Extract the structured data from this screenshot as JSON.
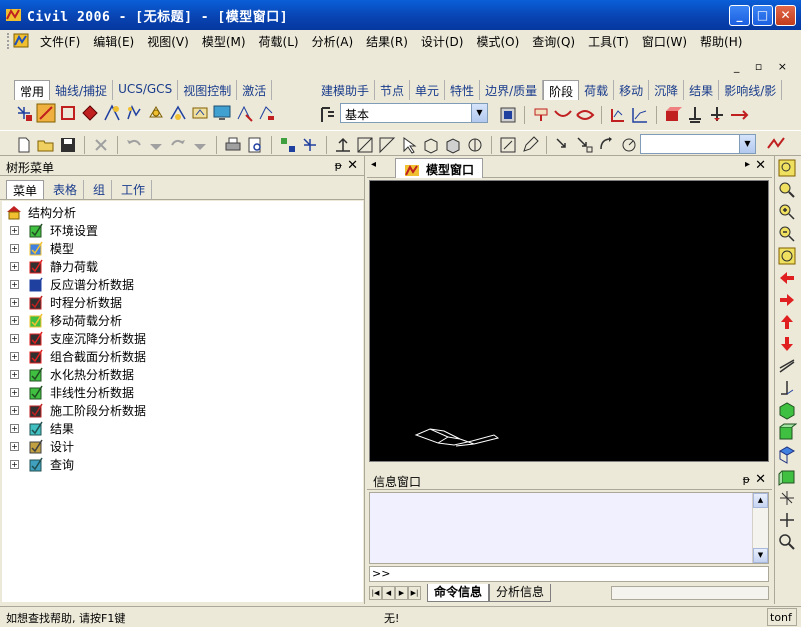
{
  "window": {
    "title": "Civil 2006 - [无标题] - [模型窗口]",
    "minimize": "_",
    "maximize": "□",
    "close": "✕"
  },
  "menu": {
    "items": [
      "文件(F)",
      "编辑(E)",
      "视图(V)",
      "模型(M)",
      "荷载(L)",
      "分析(A)",
      "结果(R)",
      "设计(D)",
      "模式(O)",
      "查询(Q)",
      "工具(T)",
      "窗口(W)",
      "帮助(H)"
    ],
    "mdi_controls": "_ ▫ ×"
  },
  "toolbar_tabs_left": [
    "常用",
    "轴线/捕捉",
    "UCS/GCS",
    "视图控制",
    "激活"
  ],
  "toolbar_tabs_right": [
    "建模助手",
    "节点",
    "单元",
    "特性",
    "边界/质量",
    "阶段",
    "荷载",
    "移动",
    "沉降",
    "结果",
    "影响线/影"
  ],
  "toolbar_active_left": "常用",
  "toolbar_active_right": "阶段",
  "stage_select": {
    "value": "基本"
  },
  "tree_panel": {
    "title": "树形菜单",
    "pin": "ᵽ",
    "close": "✕",
    "subtabs": [
      "菜单",
      "表格",
      "组",
      "工作"
    ],
    "active_subtab": "菜单",
    "root": "结构分析",
    "items": [
      {
        "label": "环境设置",
        "icon": "settings-check-icon"
      },
      {
        "label": "模型",
        "icon": "model-cube-icon"
      },
      {
        "label": "静力荷载",
        "icon": "static-load-icon"
      },
      {
        "label": "反应谱分析数据",
        "icon": "response-spectrum-icon"
      },
      {
        "label": "时程分析数据",
        "icon": "time-history-icon"
      },
      {
        "label": "移动荷载分析",
        "icon": "moving-load-icon"
      },
      {
        "label": "支座沉降分析数据",
        "icon": "support-settlement-icon"
      },
      {
        "label": "组合截面分析数据",
        "icon": "composite-section-icon"
      },
      {
        "label": "水化热分析数据",
        "icon": "heat-hydration-icon"
      },
      {
        "label": "非线性分析数据",
        "icon": "nonlinear-icon"
      },
      {
        "label": "施工阶段分析数据",
        "icon": "construction-stage-icon"
      },
      {
        "label": "结果",
        "icon": "results-icon"
      },
      {
        "label": "设计",
        "icon": "design-icon"
      },
      {
        "label": "查询",
        "icon": "query-icon"
      }
    ]
  },
  "model_window": {
    "tab_label": "模型窗口",
    "close": "✕",
    "nav_left": "◂",
    "nav_right": "▸"
  },
  "info_window": {
    "title": "信息窗口",
    "prompt": ">>",
    "tabs": [
      "命令信息",
      "分析信息"
    ],
    "active_tab": "命令信息"
  },
  "status": {
    "help": "如想查找帮助, 请按F1键",
    "middle": "无!",
    "unit": "tonf"
  }
}
